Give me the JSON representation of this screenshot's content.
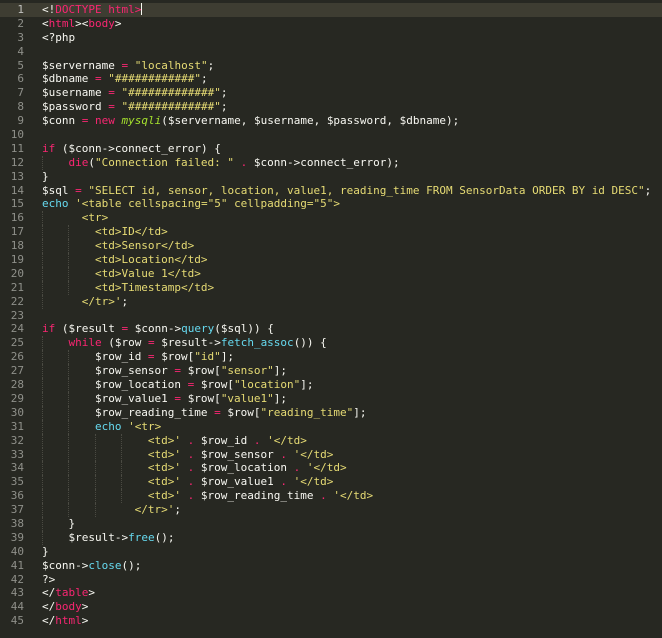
{
  "editor": {
    "theme": "monokai",
    "colors": {
      "background": "#272822",
      "plain": "#f8f8f2",
      "tag": "#f92672",
      "string": "#e6db74",
      "keyword": "#f92672",
      "function": "#66d9ef",
      "class": "#a6e22e",
      "line_number": "#8f908a",
      "active_line": "#3e3d32"
    },
    "active_line": 1,
    "lines": [
      {
        "n": "1",
        "indent": 0,
        "tokens": [
          {
            "t": "<!",
            "c": "plain"
          },
          {
            "t": "DOCTYPE",
            "c": "tag"
          },
          {
            "t": " html>",
            "c": "tag"
          }
        ]
      },
      {
        "n": "2",
        "indent": 0,
        "tokens": [
          {
            "t": "<",
            "c": "plain"
          },
          {
            "t": "html",
            "c": "tag"
          },
          {
            "t": "><",
            "c": "plain"
          },
          {
            "t": "body",
            "c": "tag"
          },
          {
            "t": ">",
            "c": "plain"
          }
        ]
      },
      {
        "n": "3",
        "indent": 0,
        "tokens": [
          {
            "t": "<?php",
            "c": "plain"
          }
        ]
      },
      {
        "n": "4",
        "indent": 0,
        "tokens": []
      },
      {
        "n": "5",
        "indent": 0,
        "tokens": [
          {
            "t": "$servername",
            "c": "plain"
          },
          {
            "t": " = ",
            "c": "kw"
          },
          {
            "t": "\"localhost\"",
            "c": "str"
          },
          {
            "t": ";",
            "c": "plain"
          }
        ]
      },
      {
        "n": "6",
        "indent": 0,
        "tokens": [
          {
            "t": "$dbname",
            "c": "plain"
          },
          {
            "t": " = ",
            "c": "kw"
          },
          {
            "t": "\"############\"",
            "c": "str"
          },
          {
            "t": ";",
            "c": "plain"
          }
        ]
      },
      {
        "n": "7",
        "indent": 0,
        "tokens": [
          {
            "t": "$username",
            "c": "plain"
          },
          {
            "t": " = ",
            "c": "kw"
          },
          {
            "t": "\"#############\"",
            "c": "str"
          },
          {
            "t": ";",
            "c": "plain"
          }
        ]
      },
      {
        "n": "8",
        "indent": 0,
        "tokens": [
          {
            "t": "$password",
            "c": "plain"
          },
          {
            "t": " = ",
            "c": "kw"
          },
          {
            "t": "\"#############\"",
            "c": "str"
          },
          {
            "t": ";",
            "c": "plain"
          }
        ]
      },
      {
        "n": "9",
        "indent": 0,
        "tokens": [
          {
            "t": "$conn",
            "c": "plain"
          },
          {
            "t": " = ",
            "c": "kw"
          },
          {
            "t": "new",
            "c": "kw"
          },
          {
            "t": " ",
            "c": "plain"
          },
          {
            "t": "mysqli",
            "c": "cls"
          },
          {
            "t": "($servername, $username, $password, $dbname);",
            "c": "plain"
          }
        ]
      },
      {
        "n": "10",
        "indent": 0,
        "tokens": []
      },
      {
        "n": "11",
        "indent": 0,
        "tokens": [
          {
            "t": "if",
            "c": "kw"
          },
          {
            "t": " ($conn->connect_error) {",
            "c": "plain"
          }
        ]
      },
      {
        "n": "12",
        "indent": 4,
        "tokens": [
          {
            "t": "die",
            "c": "kw"
          },
          {
            "t": "(",
            "c": "plain"
          },
          {
            "t": "\"Connection failed: \"",
            "c": "str"
          },
          {
            "t": " . ",
            "c": "kw"
          },
          {
            "t": "$conn->connect_error);",
            "c": "plain"
          }
        ]
      },
      {
        "n": "13",
        "indent": 0,
        "tokens": [
          {
            "t": "}",
            "c": "plain"
          }
        ]
      },
      {
        "n": "14",
        "indent": 0,
        "tokens": [
          {
            "t": "$sql",
            "c": "plain"
          },
          {
            "t": " = ",
            "c": "kw"
          },
          {
            "t": "\"SELECT id, sensor, location, value1, reading_time FROM SensorData ORDER BY id DESC\"",
            "c": "str"
          },
          {
            "t": ";",
            "c": "plain"
          }
        ]
      },
      {
        "n": "15",
        "indent": 0,
        "tokens": [
          {
            "t": "echo",
            "c": "fn"
          },
          {
            "t": " '<table cellspacing=\"5\" cellpadding=\"5\">",
            "c": "str"
          }
        ]
      },
      {
        "n": "16",
        "indent": 6,
        "tokens": [
          {
            "t": "<tr>",
            "c": "str"
          }
        ]
      },
      {
        "n": "17",
        "indent": 8,
        "tokens": [
          {
            "t": "<td>ID</td>",
            "c": "str"
          }
        ]
      },
      {
        "n": "18",
        "indent": 8,
        "tokens": [
          {
            "t": "<td>Sensor</td>",
            "c": "str"
          }
        ]
      },
      {
        "n": "19",
        "indent": 8,
        "tokens": [
          {
            "t": "<td>Location</td>",
            "c": "str"
          }
        ]
      },
      {
        "n": "20",
        "indent": 8,
        "tokens": [
          {
            "t": "<td>Value 1</td>",
            "c": "str"
          }
        ]
      },
      {
        "n": "21",
        "indent": 8,
        "tokens": [
          {
            "t": "<td>Timestamp</td>",
            "c": "str"
          }
        ]
      },
      {
        "n": "22",
        "indent": 6,
        "tokens": [
          {
            "t": "</tr>'",
            "c": "str"
          },
          {
            "t": ";",
            "c": "plain"
          }
        ]
      },
      {
        "n": "23",
        "indent": 0,
        "tokens": []
      },
      {
        "n": "24",
        "indent": 0,
        "tokens": [
          {
            "t": "if",
            "c": "kw"
          },
          {
            "t": " ($result",
            "c": "plain"
          },
          {
            "t": " = ",
            "c": "kw"
          },
          {
            "t": "$conn->",
            "c": "plain"
          },
          {
            "t": "query",
            "c": "fn"
          },
          {
            "t": "($sql)) {",
            "c": "plain"
          }
        ]
      },
      {
        "n": "25",
        "indent": 4,
        "tokens": [
          {
            "t": "while",
            "c": "kw"
          },
          {
            "t": " ($row",
            "c": "plain"
          },
          {
            "t": " = ",
            "c": "kw"
          },
          {
            "t": "$result->",
            "c": "plain"
          },
          {
            "t": "fetch_assoc",
            "c": "fn"
          },
          {
            "t": "()) {",
            "c": "plain"
          }
        ]
      },
      {
        "n": "26",
        "indent": 8,
        "tokens": [
          {
            "t": "$row_id",
            "c": "plain"
          },
          {
            "t": " = ",
            "c": "kw"
          },
          {
            "t": "$row[",
            "c": "plain"
          },
          {
            "t": "\"id\"",
            "c": "str"
          },
          {
            "t": "];",
            "c": "plain"
          }
        ]
      },
      {
        "n": "27",
        "indent": 8,
        "tokens": [
          {
            "t": "$row_sensor",
            "c": "plain"
          },
          {
            "t": " = ",
            "c": "kw"
          },
          {
            "t": "$row[",
            "c": "plain"
          },
          {
            "t": "\"sensor\"",
            "c": "str"
          },
          {
            "t": "];",
            "c": "plain"
          }
        ]
      },
      {
        "n": "28",
        "indent": 8,
        "tokens": [
          {
            "t": "$row_location",
            "c": "plain"
          },
          {
            "t": " = ",
            "c": "kw"
          },
          {
            "t": "$row[",
            "c": "plain"
          },
          {
            "t": "\"location\"",
            "c": "str"
          },
          {
            "t": "];",
            "c": "plain"
          }
        ]
      },
      {
        "n": "29",
        "indent": 8,
        "tokens": [
          {
            "t": "$row_value1",
            "c": "plain"
          },
          {
            "t": " = ",
            "c": "kw"
          },
          {
            "t": "$row[",
            "c": "plain"
          },
          {
            "t": "\"value1\"",
            "c": "str"
          },
          {
            "t": "];",
            "c": "plain"
          }
        ]
      },
      {
        "n": "30",
        "indent": 8,
        "tokens": [
          {
            "t": "$row_reading_time",
            "c": "plain"
          },
          {
            "t": " = ",
            "c": "kw"
          },
          {
            "t": "$row[",
            "c": "plain"
          },
          {
            "t": "\"reading_time\"",
            "c": "str"
          },
          {
            "t": "];",
            "c": "plain"
          }
        ]
      },
      {
        "n": "31",
        "indent": 8,
        "tokens": [
          {
            "t": "echo",
            "c": "fn"
          },
          {
            "t": " '<tr>",
            "c": "str"
          }
        ]
      },
      {
        "n": "32",
        "indent": 16,
        "tokens": [
          {
            "t": "<td>'",
            "c": "str"
          },
          {
            "t": " . ",
            "c": "kw"
          },
          {
            "t": "$row_id",
            "c": "plain"
          },
          {
            "t": " . ",
            "c": "kw"
          },
          {
            "t": "'</td>",
            "c": "str"
          }
        ]
      },
      {
        "n": "33",
        "indent": 16,
        "tokens": [
          {
            "t": "<td>'",
            "c": "str"
          },
          {
            "t": " . ",
            "c": "kw"
          },
          {
            "t": "$row_sensor",
            "c": "plain"
          },
          {
            "t": " . ",
            "c": "kw"
          },
          {
            "t": "'</td>",
            "c": "str"
          }
        ]
      },
      {
        "n": "34",
        "indent": 16,
        "tokens": [
          {
            "t": "<td>'",
            "c": "str"
          },
          {
            "t": " . ",
            "c": "kw"
          },
          {
            "t": "$row_location",
            "c": "plain"
          },
          {
            "t": " . ",
            "c": "kw"
          },
          {
            "t": "'</td>",
            "c": "str"
          }
        ]
      },
      {
        "n": "35",
        "indent": 16,
        "tokens": [
          {
            "t": "<td>'",
            "c": "str"
          },
          {
            "t": " . ",
            "c": "kw"
          },
          {
            "t": "$row_value1",
            "c": "plain"
          },
          {
            "t": " . ",
            "c": "kw"
          },
          {
            "t": "'</td>",
            "c": "str"
          }
        ]
      },
      {
        "n": "36",
        "indent": 16,
        "tokens": [
          {
            "t": "<td>'",
            "c": "str"
          },
          {
            "t": " . ",
            "c": "kw"
          },
          {
            "t": "$row_reading_time",
            "c": "plain"
          },
          {
            "t": " . ",
            "c": "kw"
          },
          {
            "t": "'</td>",
            "c": "str"
          }
        ]
      },
      {
        "n": "37",
        "indent": 14,
        "tokens": [
          {
            "t": "</tr>'",
            "c": "str"
          },
          {
            "t": ";",
            "c": "plain"
          }
        ]
      },
      {
        "n": "38",
        "indent": 4,
        "tokens": [
          {
            "t": "}",
            "c": "plain"
          }
        ]
      },
      {
        "n": "39",
        "indent": 4,
        "tokens": [
          {
            "t": "$result->",
            "c": "plain"
          },
          {
            "t": "free",
            "c": "fn"
          },
          {
            "t": "();",
            "c": "plain"
          }
        ]
      },
      {
        "n": "40",
        "indent": 0,
        "tokens": [
          {
            "t": "}",
            "c": "plain"
          }
        ]
      },
      {
        "n": "41",
        "indent": 0,
        "tokens": [
          {
            "t": "$conn->",
            "c": "plain"
          },
          {
            "t": "close",
            "c": "fn"
          },
          {
            "t": "();",
            "c": "plain"
          }
        ]
      },
      {
        "n": "42",
        "indent": 0,
        "tokens": [
          {
            "t": "?>",
            "c": "plain"
          }
        ]
      },
      {
        "n": "43",
        "indent": 0,
        "tokens": [
          {
            "t": "</",
            "c": "plain"
          },
          {
            "t": "table",
            "c": "tag"
          },
          {
            "t": ">",
            "c": "plain"
          }
        ]
      },
      {
        "n": "44",
        "indent": 0,
        "tokens": [
          {
            "t": "</",
            "c": "plain"
          },
          {
            "t": "body",
            "c": "tag"
          },
          {
            "t": ">",
            "c": "plain"
          }
        ]
      },
      {
        "n": "45",
        "indent": 0,
        "tokens": [
          {
            "t": "</",
            "c": "plain"
          },
          {
            "t": "html",
            "c": "tag"
          },
          {
            "t": ">",
            "c": "plain"
          }
        ]
      }
    ]
  }
}
